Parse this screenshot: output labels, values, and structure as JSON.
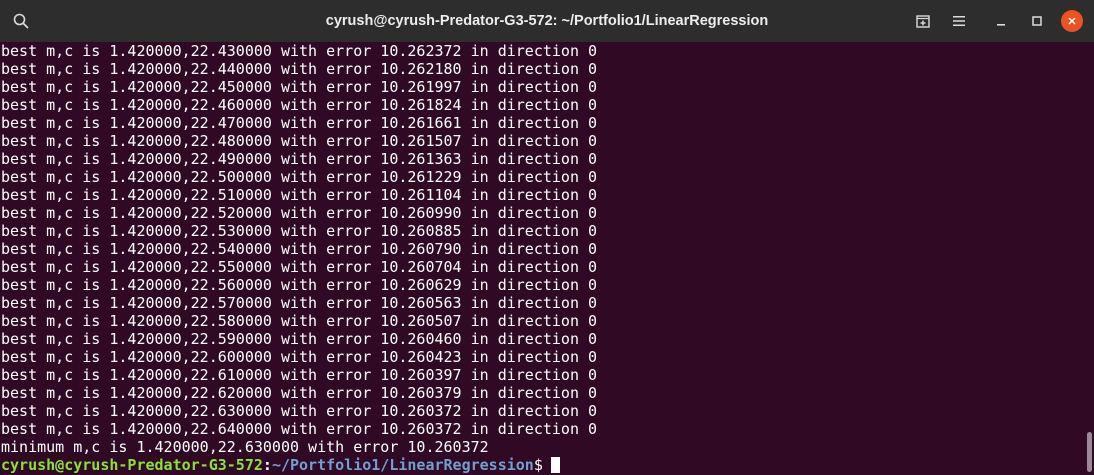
{
  "window": {
    "title": "cyrush@cyrush-Predator-G3-572: ~/Portfolio1/LinearRegression"
  },
  "titlebar_icons": {
    "search": "search-icon",
    "new_tab": "new-tab-icon",
    "menu": "hamburger-menu-icon",
    "minimize": "minimize-icon",
    "maximize": "maximize-icon",
    "close": "close-icon"
  },
  "terminal": {
    "lines": [
      "best m,c is 1.420000,22.430000 with error 10.262372 in direction 0",
      "best m,c is 1.420000,22.440000 with error 10.262180 in direction 0",
      "best m,c is 1.420000,22.450000 with error 10.261997 in direction 0",
      "best m,c is 1.420000,22.460000 with error 10.261824 in direction 0",
      "best m,c is 1.420000,22.470000 with error 10.261661 in direction 0",
      "best m,c is 1.420000,22.480000 with error 10.261507 in direction 0",
      "best m,c is 1.420000,22.490000 with error 10.261363 in direction 0",
      "best m,c is 1.420000,22.500000 with error 10.261229 in direction 0",
      "best m,c is 1.420000,22.510000 with error 10.261104 in direction 0",
      "best m,c is 1.420000,22.520000 with error 10.260990 in direction 0",
      "best m,c is 1.420000,22.530000 with error 10.260885 in direction 0",
      "best m,c is 1.420000,22.540000 with error 10.260790 in direction 0",
      "best m,c is 1.420000,22.550000 with error 10.260704 in direction 0",
      "best m,c is 1.420000,22.560000 with error 10.260629 in direction 0",
      "best m,c is 1.420000,22.570000 with error 10.260563 in direction 0",
      "best m,c is 1.420000,22.580000 with error 10.260507 in direction 0",
      "best m,c is 1.420000,22.590000 with error 10.260460 in direction 0",
      "best m,c is 1.420000,22.600000 with error 10.260423 in direction 0",
      "best m,c is 1.420000,22.610000 with error 10.260397 in direction 0",
      "best m,c is 1.420000,22.620000 with error 10.260379 in direction 0",
      "best m,c is 1.420000,22.630000 with error 10.260372 in direction 0",
      "best m,c is 1.420000,22.640000 with error 10.260372 in direction 0",
      "minimum m,c is 1.420000,22.630000 with error 10.260372"
    ],
    "prompt": {
      "user_host": "cyrush@cyrush-Predator-G3-572",
      "separator": ":",
      "path": "~/Portfolio1/LinearRegression",
      "symbol": "$"
    }
  },
  "colors": {
    "background": "#300a24",
    "titlebar": "#2d2d2d",
    "close_button": "#e95420",
    "prompt_user": "#8ae234",
    "prompt_path": "#729fcf"
  }
}
